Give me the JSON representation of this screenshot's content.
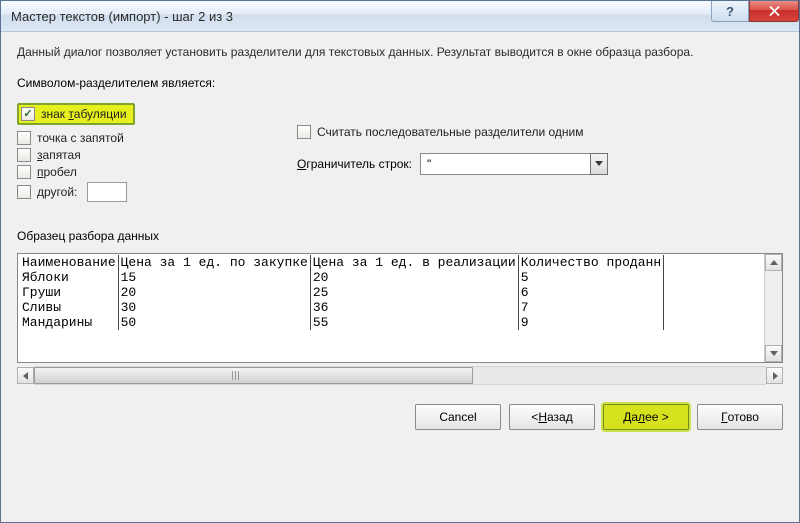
{
  "title": "Мастер текстов (импорт) - шаг 2 из 3",
  "description": "Данный диалог позволяет установить разделители для текстовых данных. Результат выводится в окне образца разбора.",
  "delimiters_label": "Символом-разделителем является:",
  "delims": {
    "tab": "знак табуляции",
    "tab_checked": true,
    "semicolon": "точка с запятой",
    "semicolon_checked": false,
    "comma": "запятая",
    "comma_checked": false,
    "space": "пробел",
    "space_checked": false,
    "other": "другой:",
    "other_checked": false,
    "other_value": ""
  },
  "treat_consecutive": {
    "label": "Считать последовательные разделители одним",
    "checked": false
  },
  "text_qualifier": {
    "label": "Ограничитель строк:",
    "value": "\""
  },
  "preview_label": "Образец разбора данных",
  "preview": {
    "headers": [
      "Наименование",
      "Цена за 1 ед. по закупке",
      "Цена за 1 ед. в реализации",
      "Количество проданн"
    ],
    "rows": [
      [
        "Яблоки",
        "15",
        "20",
        "5"
      ],
      [
        "Груши",
        "20",
        "25",
        "6"
      ],
      [
        "Сливы",
        "30",
        "36",
        "7"
      ],
      [
        "Мандарины",
        "50",
        "55",
        "9"
      ]
    ]
  },
  "buttons": {
    "cancel": "Cancel",
    "back": "< Назад",
    "next": "Далее >",
    "finish": "Готово"
  }
}
